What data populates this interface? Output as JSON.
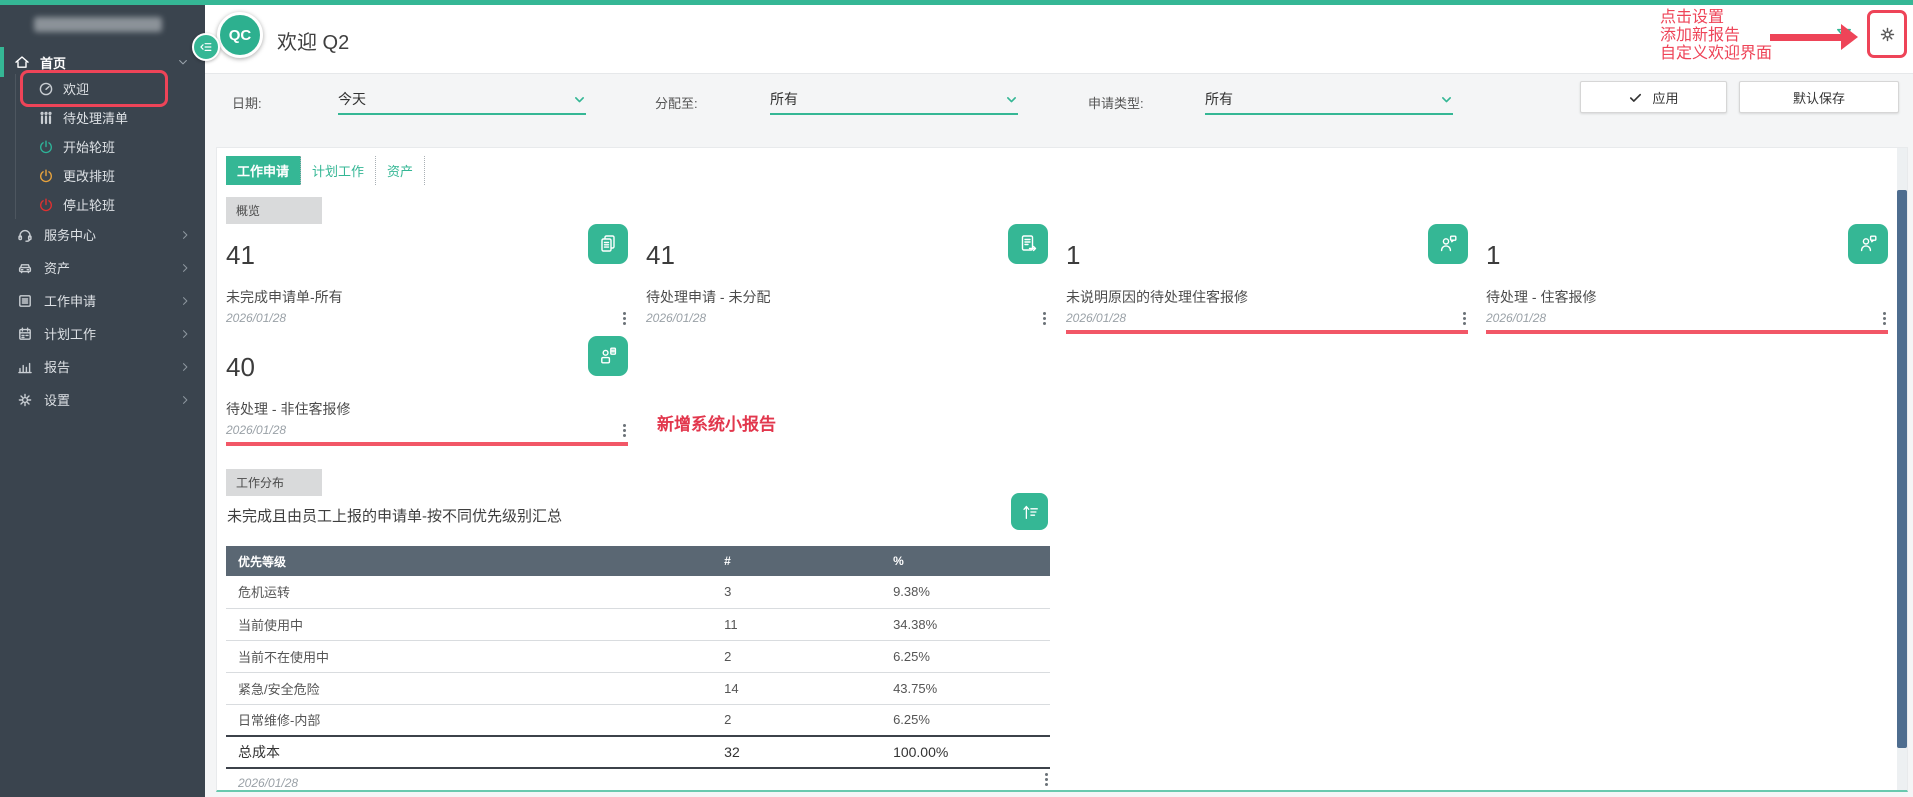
{
  "colors": {
    "accent": "#35b795",
    "annotation_red": "#ee4458",
    "card_underline_red": "#f25767",
    "sidebar_bg": "#3a444e",
    "table_header_bg": "#5a6773",
    "scrollbar_thumb": "#4e6d8f"
  },
  "sidebar": {
    "home_label": "首页",
    "home_children": [
      {
        "label": "欢迎",
        "icon": "gauge",
        "icon_name": "gauge-icon",
        "highlighted": true
      },
      {
        "label": "待处理清单",
        "icon": "bars",
        "icon_name": "pending-list-icon"
      },
      {
        "label": "开始轮班",
        "icon": "power",
        "icon_name": "power-start-icon",
        "color": "#2eb398"
      },
      {
        "label": "更改排班",
        "icon": "power",
        "icon_name": "power-change-icon",
        "color": "#e8a33d"
      },
      {
        "label": "停止轮班",
        "icon": "power",
        "icon_name": "power-stop-icon",
        "color": "#e03030"
      }
    ],
    "items": [
      {
        "label": "服务中心",
        "icon": "headset",
        "icon_name": "service-center-icon"
      },
      {
        "label": "资产",
        "icon": "car",
        "icon_name": "assets-icon"
      },
      {
        "label": "工作申请",
        "icon": "list",
        "icon_name": "work-request-icon"
      },
      {
        "label": "计划工作",
        "icon": "calendar",
        "icon_name": "planned-work-icon"
      },
      {
        "label": "报告",
        "icon": "chart",
        "icon_name": "reports-icon"
      },
      {
        "label": "设置",
        "icon": "gear",
        "icon_name": "settings-icon"
      }
    ]
  },
  "header": {
    "avatar": "QC",
    "title": "欢迎 Q2"
  },
  "annotations": {
    "settings_note": [
      "点击设置",
      "添加新报告",
      "自定义欢迎界面"
    ],
    "new_report_note": "新增系统小报告"
  },
  "filters": {
    "date_label": "日期:",
    "date_value": "今天",
    "assigned_label": "分配至:",
    "assigned_value": "所有",
    "type_label": "申请类型:",
    "type_value": "所有",
    "apply_label": "应用",
    "save_default_label": "默认保存"
  },
  "tabs": [
    {
      "label": "工作申请",
      "active": true
    },
    {
      "label": "计划工作",
      "active": false
    },
    {
      "label": "资产",
      "active": false
    }
  ],
  "overview": {
    "section_label": "概览",
    "cards": [
      {
        "value": "41",
        "label": "未完成申请单-所有",
        "date": "2026/01/28",
        "icon": "docs",
        "icon_name": "work-orders-stack-icon",
        "underline": false
      },
      {
        "value": "41",
        "label": "待处理申请 - 未分配",
        "date": "2026/01/28",
        "icon": "docExport",
        "icon_name": "pending-doc-icon",
        "underline": false
      },
      {
        "value": "1",
        "label": "未说明原因的待处理住客报修",
        "date": "2026/01/28",
        "icon": "personChat",
        "icon_name": "guest-chat-icon",
        "underline": true
      },
      {
        "value": "1",
        "label": "待处理 - 住客报修",
        "date": "2026/01/28",
        "icon": "personChat",
        "icon_name": "guest-chat-icon",
        "underline": true
      },
      {
        "value": "40",
        "label": "待处理 - 非住客报修",
        "date": "2026/01/28",
        "icon": "personClipboard",
        "icon_name": "staff-clipboard-icon",
        "underline": true
      }
    ]
  },
  "distribution": {
    "section_label": "工作分布",
    "date": "2026/01/28"
  },
  "chart_data": {
    "type": "table",
    "title": "未完成且由员工上报的申请单-按不同优先级别汇总",
    "columns": [
      "优先等级",
      "#",
      "%"
    ],
    "rows": [
      [
        "危机运转",
        "3",
        "9.38%"
      ],
      [
        "当前使用中",
        "11",
        "34.38%"
      ],
      [
        "当前不在使用中",
        "2",
        "6.25%"
      ],
      [
        "紧急/安全危险",
        "14",
        "43.75%"
      ],
      [
        "日常维修-内部",
        "2",
        "6.25%"
      ],
      [
        "总成本",
        "32",
        "100.00%"
      ]
    ]
  }
}
